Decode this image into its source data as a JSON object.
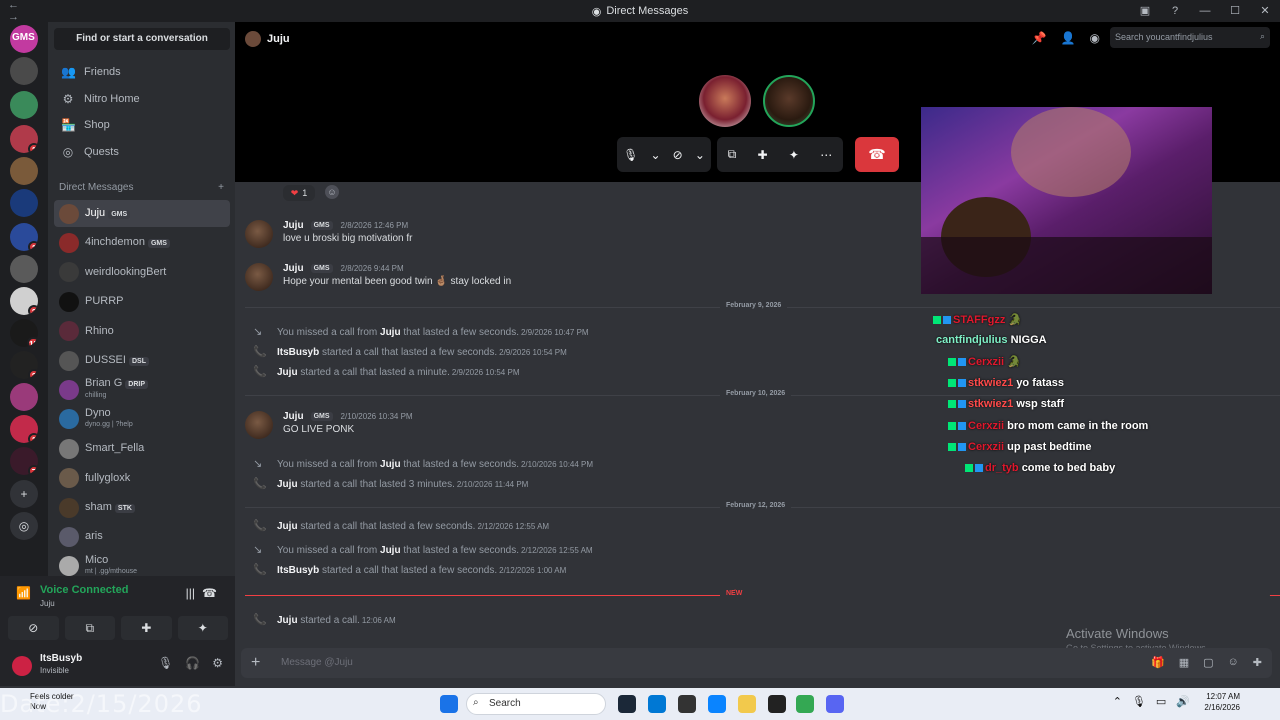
{
  "titlebar": {
    "title": "Direct Messages",
    "nav": "← →"
  },
  "sidebar": {
    "find": "Find or start a conversation",
    "nav": [
      {
        "icon": "👥",
        "label": "Friends"
      },
      {
        "icon": "⚙",
        "label": "Nitro Home"
      },
      {
        "icon": "🏪",
        "label": "Shop"
      },
      {
        "icon": "◎",
        "label": "Quests"
      }
    ],
    "dm_header": "Direct Messages",
    "dm_add": "+",
    "dms": [
      {
        "name": "Juju",
        "tag": "GMS",
        "sub": "",
        "color": "#6b4a3a"
      },
      {
        "name": "4inchdemon",
        "tag": "GMS",
        "sub": "",
        "color": "#8a2a2a"
      },
      {
        "name": "weirdlookingBert",
        "tag": "",
        "sub": "",
        "color": "#3a3a3a"
      },
      {
        "name": "PURRP",
        "tag": "",
        "sub": "",
        "color": "#111"
      },
      {
        "name": "Rhino",
        "tag": "",
        "sub": "",
        "color": "#5a2a3a"
      },
      {
        "name": "DUSSEI",
        "tag": "DSL",
        "sub": "",
        "color": "#555"
      },
      {
        "name": "Brian G",
        "tag": "DRIP",
        "sub": "chilling",
        "color": "#7a3a8a"
      },
      {
        "name": "Dyno",
        "tag": "",
        "sub": "dyno.gg | ?help",
        "color": "#2a6aa0"
      },
      {
        "name": "Smart_Fella",
        "tag": "",
        "sub": "",
        "color": "#777"
      },
      {
        "name": "fullygloxk",
        "tag": "",
        "sub": "",
        "color": "#6a5a4a"
      },
      {
        "name": "sham",
        "tag": "STK",
        "sub": "",
        "color": "#4a3a2a"
      },
      {
        "name": "aris",
        "tag": "",
        "sub": "",
        "color": "#5a5a6a"
      },
      {
        "name": "Mico",
        "tag": "",
        "sub": "mt | .gg/mthouse",
        "color": "#aaa"
      }
    ],
    "voice_status": "Voice Connected",
    "voice_channel": "Juju",
    "user_name": "ItsBusyb",
    "user_status": "Invisible"
  },
  "servers": [
    {
      "label": "GMS",
      "badge": ""
    },
    {
      "badge": ""
    },
    {
      "badge": ""
    },
    {
      "badge": "1"
    },
    {
      "badge": ""
    },
    {
      "badge": ""
    },
    {
      "badge": "1"
    },
    {
      "badge": ""
    },
    {
      "badge": "2"
    },
    {
      "badge": "15"
    },
    {
      "badge": "2"
    },
    {
      "badge": ""
    },
    {
      "badge": "1"
    },
    {
      "badge": "7"
    }
  ],
  "channel": {
    "name": "Juju",
    "search_placeholder": "Search youcantfindjulius"
  },
  "messages": [
    {
      "type": "react",
      "count": "1"
    },
    {
      "type": "msg",
      "author": "Juju",
      "tag": "GMS",
      "time": "2/8/2026 12:46 PM",
      "text": "love u broski big motivation fr"
    },
    {
      "type": "msg",
      "author": "Juju",
      "tag": "GMS",
      "time": "2/8/2026 9:44 PM",
      "text": "Hope your mental been good  twin 🤞🏽 stay locked in"
    },
    {
      "type": "sep",
      "text": "February 9, 2026"
    },
    {
      "type": "missed",
      "pre": "You missed a call from ",
      "who": "Juju",
      "post": " that lasted a few seconds.",
      "time": "2/9/2026 10:47 PM"
    },
    {
      "type": "call",
      "who": "ItsBusyb",
      "post": " started a call that lasted a few seconds.",
      "time": "2/9/2026 10:54 PM"
    },
    {
      "type": "call",
      "who": "Juju",
      "post": " started a call that lasted a minute.",
      "time": "2/9/2026 10:54 PM"
    },
    {
      "type": "sep",
      "text": "February 10, 2026"
    },
    {
      "type": "msg",
      "author": "Juju",
      "tag": "GMS",
      "time": "2/10/2026 10:34 PM",
      "text": "GO LIVE PONK"
    },
    {
      "type": "missed",
      "pre": "You missed a call from ",
      "who": "Juju",
      "post": " that lasted a few seconds.",
      "time": "2/10/2026 10:44 PM"
    },
    {
      "type": "call",
      "who": "Juju",
      "post": " started a call that lasted 3 minutes.",
      "time": "2/10/2026 11:44 PM"
    },
    {
      "type": "sep",
      "text": "February 12, 2026"
    },
    {
      "type": "call",
      "who": "Juju",
      "post": " started a call that lasted a few seconds.",
      "time": "2/12/2026 12:55 AM"
    },
    {
      "type": "missed",
      "pre": "You missed a call from ",
      "who": "Juju",
      "post": " that lasted a few seconds.",
      "time": "2/12/2026 12:55 AM"
    },
    {
      "type": "call",
      "who": "ItsBusyb",
      "post": " started a call that lasted a few seconds.",
      "time": "2/12/2026 1:00 AM"
    },
    {
      "type": "sep",
      "text": "February 16, 2026",
      "new": "NEW"
    },
    {
      "type": "call",
      "who": "Juju",
      "post": " started a call.",
      "time": "12:06 AM"
    }
  ],
  "twitch_chat": [
    {
      "name": "STAFFgzz",
      "text": "🐊",
      "name_color": "#e0182d"
    },
    {
      "name": "cantfindjulius",
      "text": "NIGGA",
      "name_color": "#7ff0c6"
    },
    {
      "name": "Cerxzii",
      "text": "🐊",
      "name_color": "#e0182d"
    },
    {
      "name": "stkwiez1",
      "text": "yo fatass",
      "name_color": "#ff4a4a"
    },
    {
      "name": "stkwiez1",
      "text": "wsp staff",
      "name_color": "#ff4a4a"
    },
    {
      "name": "Cerxzii",
      "text": "bro mom came in the room",
      "name_color": "#e0182d"
    },
    {
      "name": "Cerxzii",
      "text": "up past bedtime",
      "name_color": "#e0182d"
    },
    {
      "name": "dr_tyb",
      "text": "come to bed baby",
      "name_color": "#e0182d"
    }
  ],
  "composer": {
    "placeholder": "Message @Juju"
  },
  "activate": {
    "title": "Activate Windows",
    "sub": "Go to Settings to activate Windows."
  },
  "taskbar": {
    "search": "Search",
    "time": "12:07 AM",
    "date": "2/16/2026",
    "weather": "Feels colder",
    "weather_sub": "Now",
    "watermark": "Date:2/15/2026"
  },
  "colors": {
    "accent": "#5865f2",
    "online": "#23a55a",
    "danger": "#da373c"
  }
}
